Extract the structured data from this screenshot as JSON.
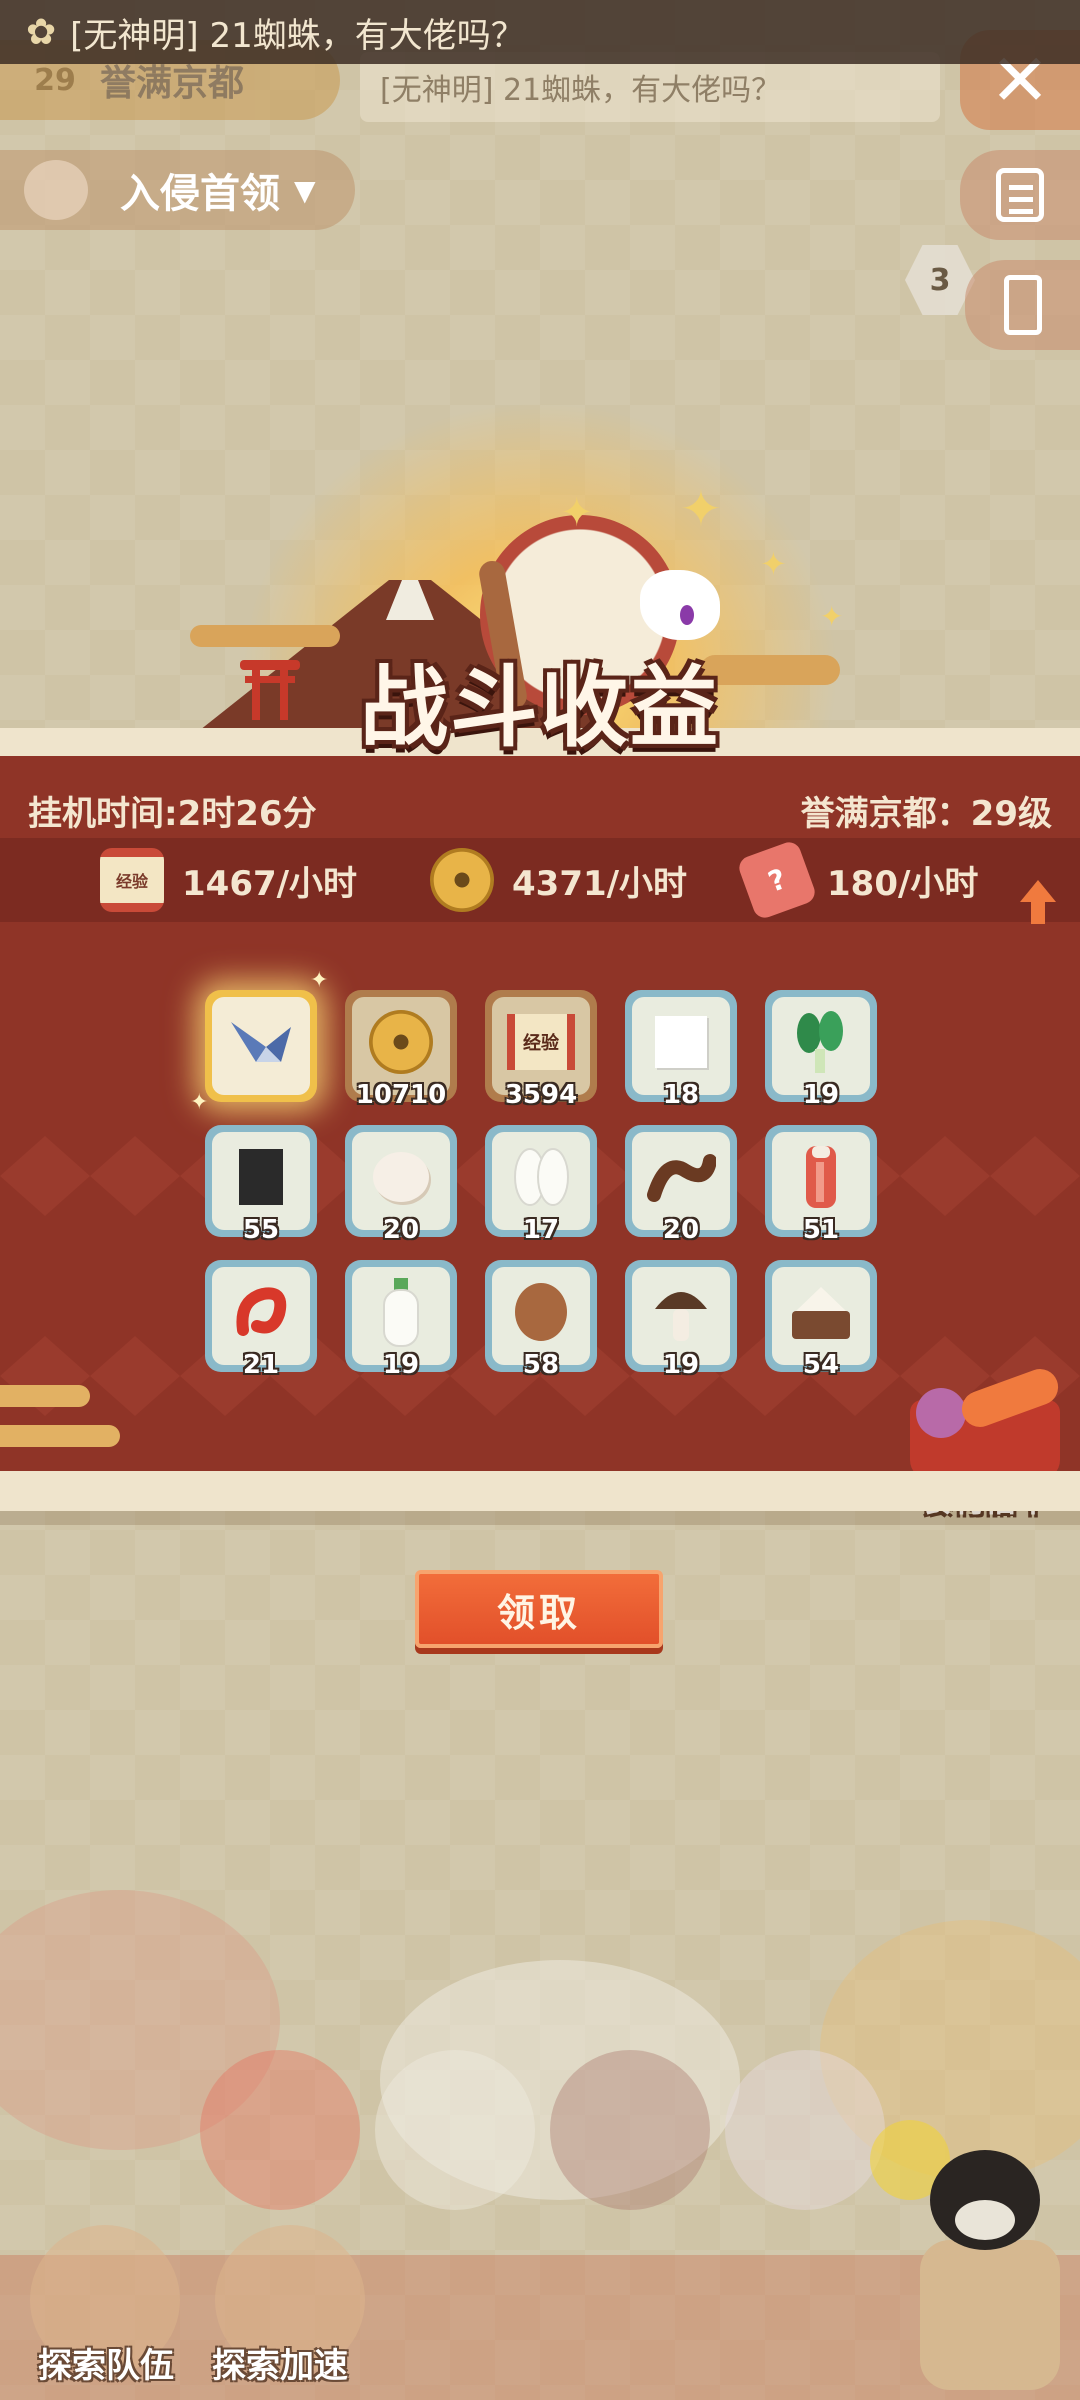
{
  "top_bar": {
    "chat_message": "[无神明] 21蜘蛛，有大佬吗？",
    "region_name": "誉满京都",
    "region_level": "29",
    "chat_ghost": "[无神明] 21蜘蛛，有大佬吗？",
    "close_icon": "✕",
    "invade_label": "入侵首领",
    "invade_arrow": "▼",
    "side_badge": "3"
  },
  "rewards_panel": {
    "title": "战斗收益",
    "idle_time": "挂机时间:2时26分",
    "region_level_text": "誉满京都：29级",
    "rates": [
      {
        "icon": "exp-scroll-icon",
        "icon_text": "经验",
        "value": "1467/小时"
      },
      {
        "icon": "coin-icon",
        "icon_text": "",
        "value": "4371/小时"
      },
      {
        "icon": "ticket-icon",
        "icon_text": "?",
        "value": "180/小时"
      }
    ],
    "items": [
      {
        "name": "rare-item",
        "count": "",
        "tile": "gold"
      },
      {
        "name": "coins",
        "count": "10710",
        "tile": "bronze"
      },
      {
        "name": "exp-scroll",
        "count": "3594",
        "tile": "bronze",
        "label": "经验"
      },
      {
        "name": "tofu",
        "count": "18",
        "tile": "blue"
      },
      {
        "name": "greens",
        "count": "19",
        "tile": "blue"
      },
      {
        "name": "seaweed",
        "count": "55",
        "tile": "blue"
      },
      {
        "name": "egg",
        "count": "20",
        "tile": "blue"
      },
      {
        "name": "rice",
        "count": "17",
        "tile": "blue"
      },
      {
        "name": "eel",
        "count": "20",
        "tile": "blue"
      },
      {
        "name": "meat",
        "count": "51",
        "tile": "blue"
      },
      {
        "name": "shrimp",
        "count": "21",
        "tile": "blue"
      },
      {
        "name": "radish",
        "count": "19",
        "tile": "blue"
      },
      {
        "name": "potato",
        "count": "58",
        "tile": "blue"
      },
      {
        "name": "mushroom",
        "count": "19",
        "tile": "blue"
      },
      {
        "name": "flour",
        "count": "54",
        "tile": "blue"
      }
    ],
    "food_multiplier_label": "食材倍率",
    "claim_label": "领取"
  },
  "bottom_bar": {
    "team_label": "探索队伍",
    "speedup_label": "探索加速"
  },
  "colors": {
    "panel_red": "#8f3427",
    "band_red": "#7c2b21",
    "tile_blue": "#8ab9c9",
    "accent_orange": "#e2502a",
    "cream": "#efe4cc"
  }
}
